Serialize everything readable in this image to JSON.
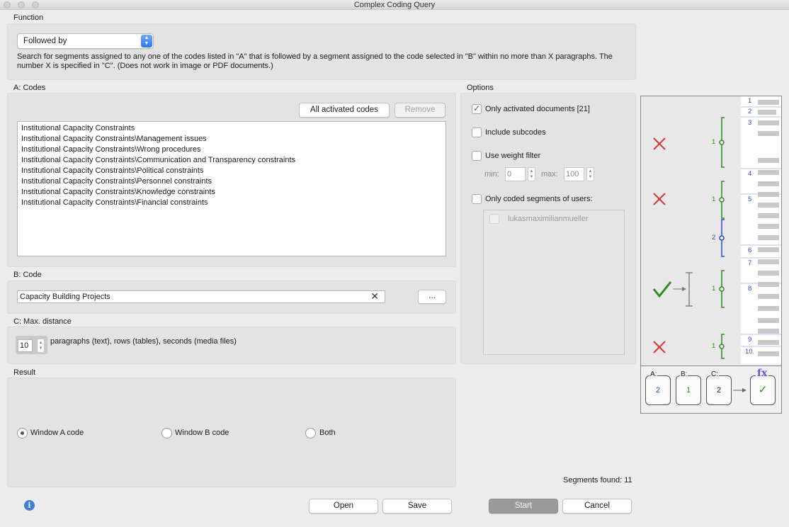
{
  "window": {
    "title": "Complex Coding Query"
  },
  "function": {
    "label": "Function",
    "selected": "Followed by",
    "description": "Search for segments assigned to any one of the codes listed in \"A\" that is followed by a segment assigned to the code selected in \"B\" within no more than X paragraphs. The number X is specified in \"C\". (Does not work in image or PDF documents.)"
  },
  "codes_a": {
    "label": "A: Codes",
    "all_activated_label": "All activated codes",
    "remove_label": "Remove",
    "items": [
      "Institutional Capacity Constraints",
      "Institutional Capacity Constraints\\Management issues",
      "Institutional Capacity Constraints\\Wrong procedures",
      "Institutional Capacity Constraints\\Communication and Transparency constraints",
      "Institutional Capacity Constraints\\Political constraints",
      "Institutional Capacity Constraints\\Personnel constraints",
      "Institutional Capacity Constraints\\Knowledge constraints",
      "Institutional Capacity Constraints\\Financial constraints"
    ]
  },
  "code_b": {
    "label": "B: Code",
    "value": "Capacity Building Projects",
    "browse_label": "..."
  },
  "distance_c": {
    "label": "C: Max. distance",
    "value": "10",
    "unit_text": "paragraphs (text), rows (tables), seconds (media files)"
  },
  "options": {
    "label": "Options",
    "only_activated_docs": {
      "label": "Only activated documents [21]",
      "checked": true
    },
    "include_subcodes": {
      "label": "Include subcodes",
      "checked": false
    },
    "weight_filter": {
      "label": "Use weight filter",
      "checked": false,
      "min_label": "min:",
      "min_value": "0",
      "max_label": "max:",
      "max_value": "100"
    },
    "only_users": {
      "label": "Only coded segments of users:",
      "checked": false,
      "users": [
        "lukasmaximilianmueller"
      ]
    }
  },
  "result": {
    "label": "Result",
    "radios": [
      {
        "label": "Window A code",
        "selected": true
      },
      {
        "label": "Window B code",
        "selected": false
      },
      {
        "label": "Both",
        "selected": false
      }
    ],
    "segments_found": "Segments found: 11"
  },
  "illustration": {
    "line_numbers": [
      "1",
      "2",
      "3",
      "4",
      "5",
      "6",
      "7",
      "8",
      "9",
      "10"
    ],
    "marker_numbers": [
      "1",
      "1",
      "2",
      "1",
      "1"
    ],
    "cards": [
      {
        "label": "A:",
        "value": "2"
      },
      {
        "label": "B:",
        "value": "1"
      },
      {
        "label": "C:",
        "value": "2"
      }
    ],
    "fx_label": "fx"
  },
  "buttons": {
    "open": "Open",
    "save": "Save",
    "start": "Start",
    "cancel": "Cancel"
  },
  "colors": {
    "green": "#2e8b1e",
    "blue": "#2a4bd0",
    "red": "#d23a3a"
  }
}
